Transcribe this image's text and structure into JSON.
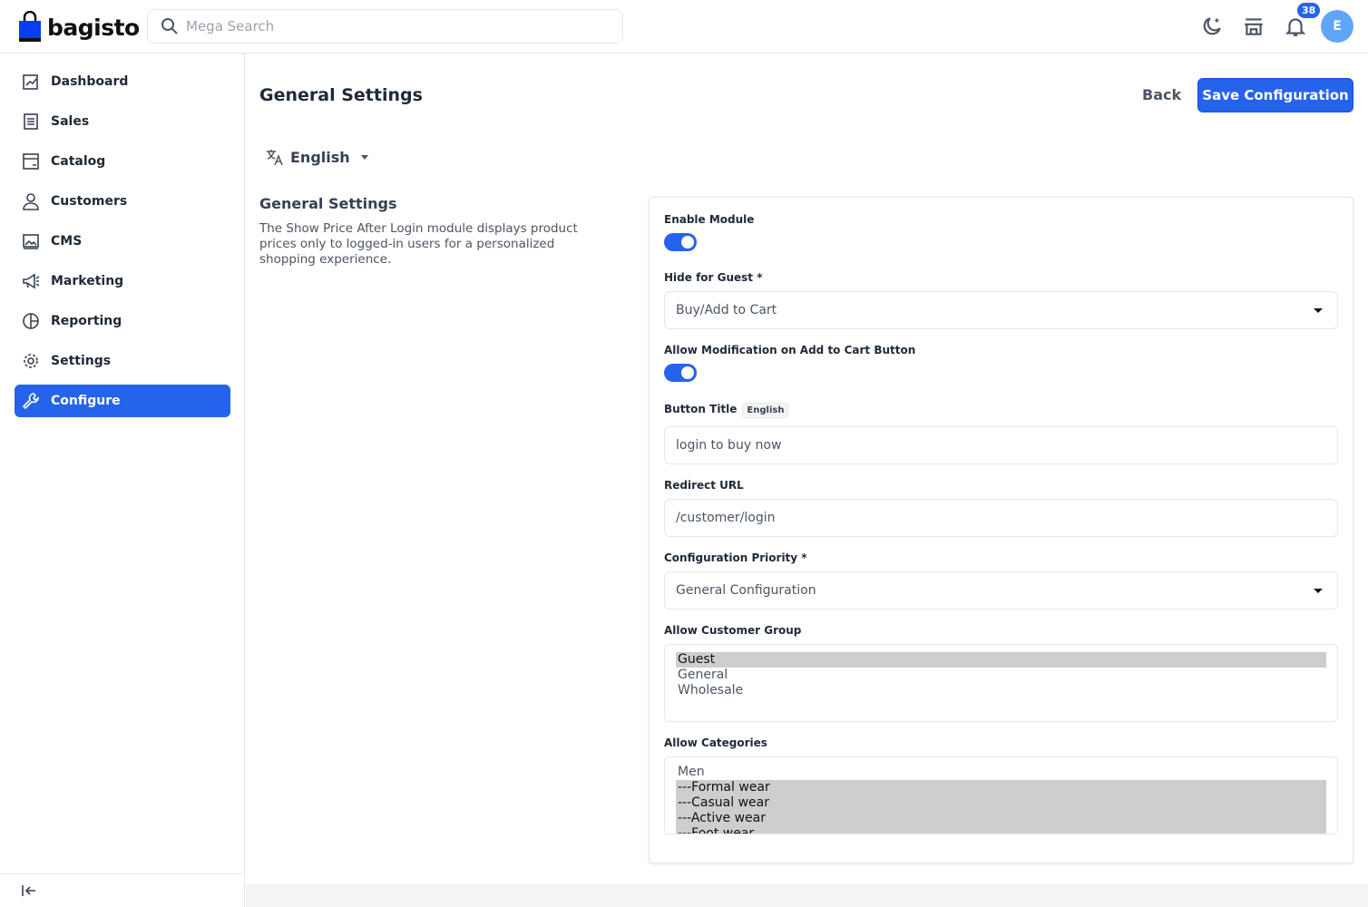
{
  "header": {
    "logo": "bagisto",
    "search_placeholder": "Mega Search",
    "notification_count": "38",
    "avatar_initial": "E"
  },
  "sidebar": {
    "items": [
      {
        "label": "Dashboard",
        "icon": "dashboard-icon"
      },
      {
        "label": "Sales",
        "icon": "sales-icon"
      },
      {
        "label": "Catalog",
        "icon": "catalog-icon"
      },
      {
        "label": "Customers",
        "icon": "customers-icon"
      },
      {
        "label": "CMS",
        "icon": "cms-icon"
      },
      {
        "label": "Marketing",
        "icon": "megaphone-icon"
      },
      {
        "label": "Reporting",
        "icon": "reporting-icon"
      },
      {
        "label": "Settings",
        "icon": "gear-icon"
      },
      {
        "label": "Configure",
        "icon": "wrench-icon",
        "active": true
      }
    ]
  },
  "page": {
    "title": "General Settings",
    "back": "Back",
    "save": "Save Configuration",
    "locale": "English"
  },
  "section": {
    "title": "General Settings",
    "description": "The Show Price After Login module displays product prices only to logged-in users for a personalized shopping experience."
  },
  "form": {
    "enable_module": {
      "label": "Enable Module",
      "value": true
    },
    "hide_for_guest": {
      "label": "Hide for Guest *",
      "value": "Buy/Add to Cart"
    },
    "allow_modification": {
      "label": "Allow Modification on Add to Cart Button",
      "value": true
    },
    "button_title": {
      "label": "Button Title",
      "locale_chip": "English",
      "value": "login to buy now"
    },
    "redirect_url": {
      "label": "Redirect URL",
      "value": "/customer/login"
    },
    "config_priority": {
      "label": "Configuration Priority *",
      "value": "General Configuration"
    },
    "customer_group": {
      "label": "Allow Customer Group",
      "options": [
        "Guest",
        "General",
        "Wholesale"
      ],
      "selected": [
        "Guest"
      ]
    },
    "categories": {
      "label": "Allow Categories",
      "options": [
        "Men",
        "---Formal wear",
        "---Casual wear",
        "---Active wear",
        "---Foot wear"
      ],
      "selected": [
        "---Formal wear",
        "---Casual wear",
        "---Active wear",
        "---Foot wear"
      ]
    }
  },
  "colors": {
    "primary": "#2563eb",
    "avatar": "#60a5fa"
  }
}
